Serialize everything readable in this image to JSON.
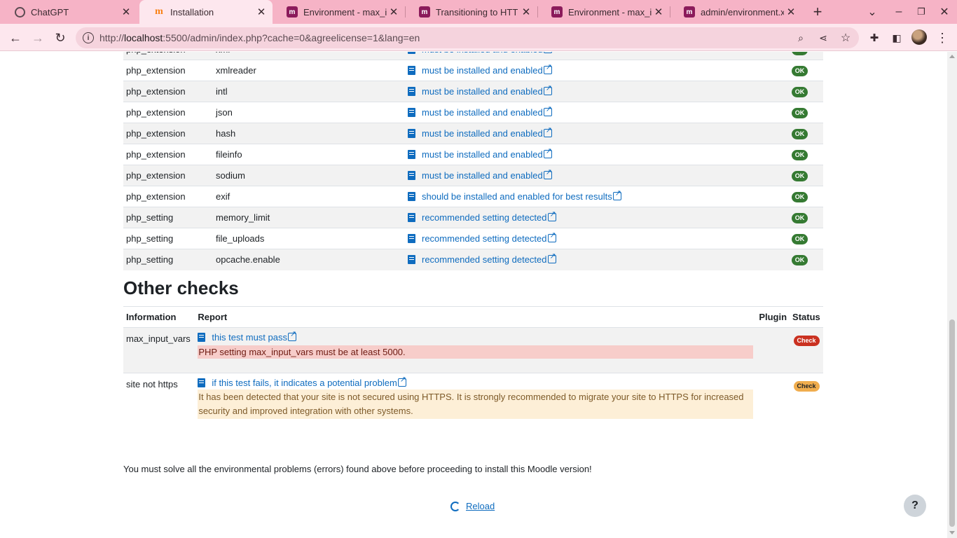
{
  "browser": {
    "tabs": [
      {
        "title": "ChatGPT",
        "icon": "chatgpt-icon"
      },
      {
        "title": "Installation",
        "icon": "moodle-m-icon",
        "active": true
      },
      {
        "title": "Environment - max_i",
        "icon": "moodle-icon"
      },
      {
        "title": "Transitioning to HTT",
        "icon": "moodle-icon"
      },
      {
        "title": "Environment - max_i",
        "icon": "moodle-icon"
      },
      {
        "title": "admin/environment.x",
        "icon": "moodle-icon"
      }
    ],
    "new_tab": "+",
    "url_host": "localhost",
    "url_prefix": "http://",
    "url_rest": ":5500/admin/index.php?cache=0&agreelicense=1&lang=en"
  },
  "php_checks": [
    {
      "name": "php_extension",
      "info": "xml",
      "report": "must be installed and enabled",
      "status": "OK"
    },
    {
      "name": "php_extension",
      "info": "xmlreader",
      "report": "must be installed and enabled",
      "status": "OK"
    },
    {
      "name": "php_extension",
      "info": "intl",
      "report": "must be installed and enabled",
      "status": "OK"
    },
    {
      "name": "php_extension",
      "info": "json",
      "report": "must be installed and enabled",
      "status": "OK"
    },
    {
      "name": "php_extension",
      "info": "hash",
      "report": "must be installed and enabled",
      "status": "OK"
    },
    {
      "name": "php_extension",
      "info": "fileinfo",
      "report": "must be installed and enabled",
      "status": "OK"
    },
    {
      "name": "php_extension",
      "info": "sodium",
      "report": "must be installed and enabled",
      "status": "OK"
    },
    {
      "name": "php_extension",
      "info": "exif",
      "report": "should be installed and enabled for best results",
      "status": "OK"
    },
    {
      "name": "php_setting",
      "info": "memory_limit",
      "report": "recommended setting detected",
      "status": "OK"
    },
    {
      "name": "php_setting",
      "info": "file_uploads",
      "report": "recommended setting detected",
      "status": "OK"
    },
    {
      "name": "php_setting",
      "info": "opcache.enable",
      "report": "recommended setting detected",
      "status": "OK"
    }
  ],
  "other_checks": {
    "heading": "Other checks",
    "columns": {
      "information": "Information",
      "report": "Report",
      "plugin": "Plugin",
      "status": "Status"
    },
    "rows": [
      {
        "information": "max_input_vars",
        "link": "this test must pass",
        "message": "PHP setting max_input_vars must be at least 5000.",
        "status": "Check",
        "level": "error"
      },
      {
        "information": "site not https",
        "link": "if this test fails, it indicates a potential problem",
        "message": "It has been detected that your site is not secured using HTTPS. It is strongly recommended to migrate your site to HTTPS for increased security and improved integration with other systems.",
        "status": "Check",
        "level": "warning"
      }
    ]
  },
  "footer_message": "You must solve all the environmental problems (errors) found above before proceeding to install this Moodle version!",
  "reload_label": "Reload",
  "help_label": "?",
  "colors": {
    "tabbar": "#f6b3c6",
    "toolbar": "#fde7ee",
    "link": "#0f6cbf",
    "ok": "#357a32",
    "error": "#ca3120",
    "warning": "#f0ad4e"
  }
}
